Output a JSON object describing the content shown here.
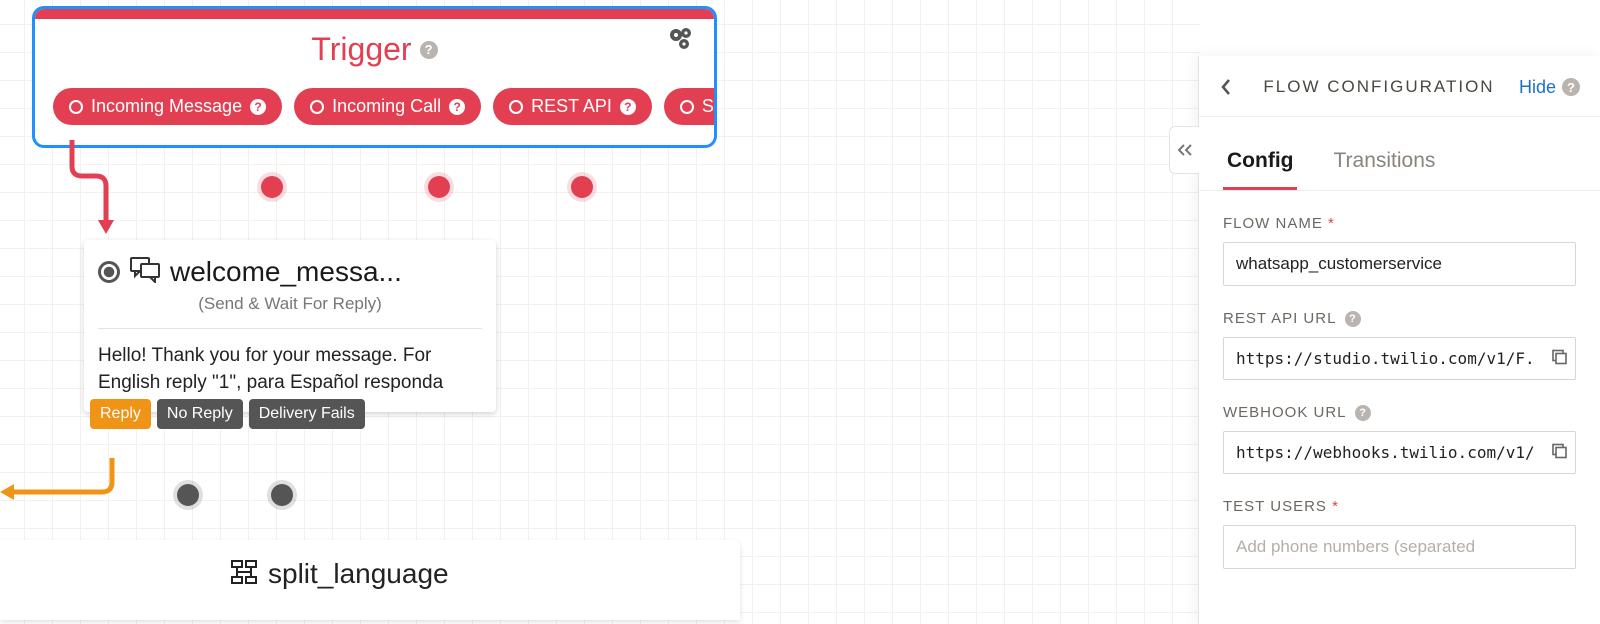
{
  "trigger": {
    "title": "Trigger",
    "outputs": [
      {
        "label": "Incoming Message"
      },
      {
        "label": "Incoming Call"
      },
      {
        "label": "REST API"
      },
      {
        "label": "Subflow"
      }
    ]
  },
  "welcome_widget": {
    "title": "welcome_messa...",
    "subtitle": "(Send & Wait For Reply)",
    "body": "Hello! Thank you for your message. For English reply \"1\", para Español responda",
    "outputs": [
      {
        "label": "Reply",
        "kind": "reply"
      },
      {
        "label": "No Reply",
        "kind": "default"
      },
      {
        "label": "Delivery Fails",
        "kind": "default"
      }
    ]
  },
  "split_widget": {
    "title": "split_language"
  },
  "panel": {
    "title": "FLOW CONFIGURATION",
    "hide_label": "Hide",
    "tabs": {
      "config": "Config",
      "transitions": "Transitions"
    },
    "fields": {
      "flow_name": {
        "label": "FLOW NAME",
        "value": "whatsapp_customerservice",
        "required": true
      },
      "rest_api": {
        "label": "REST API URL",
        "value": "https://studio.twilio.com/v1/F."
      },
      "webhook": {
        "label": "WEBHOOK URL",
        "value": "https://webhooks.twilio.com/v1/"
      },
      "test_users": {
        "label": "TEST USERS",
        "placeholder": "Add phone numbers (separated",
        "required": true
      }
    }
  }
}
